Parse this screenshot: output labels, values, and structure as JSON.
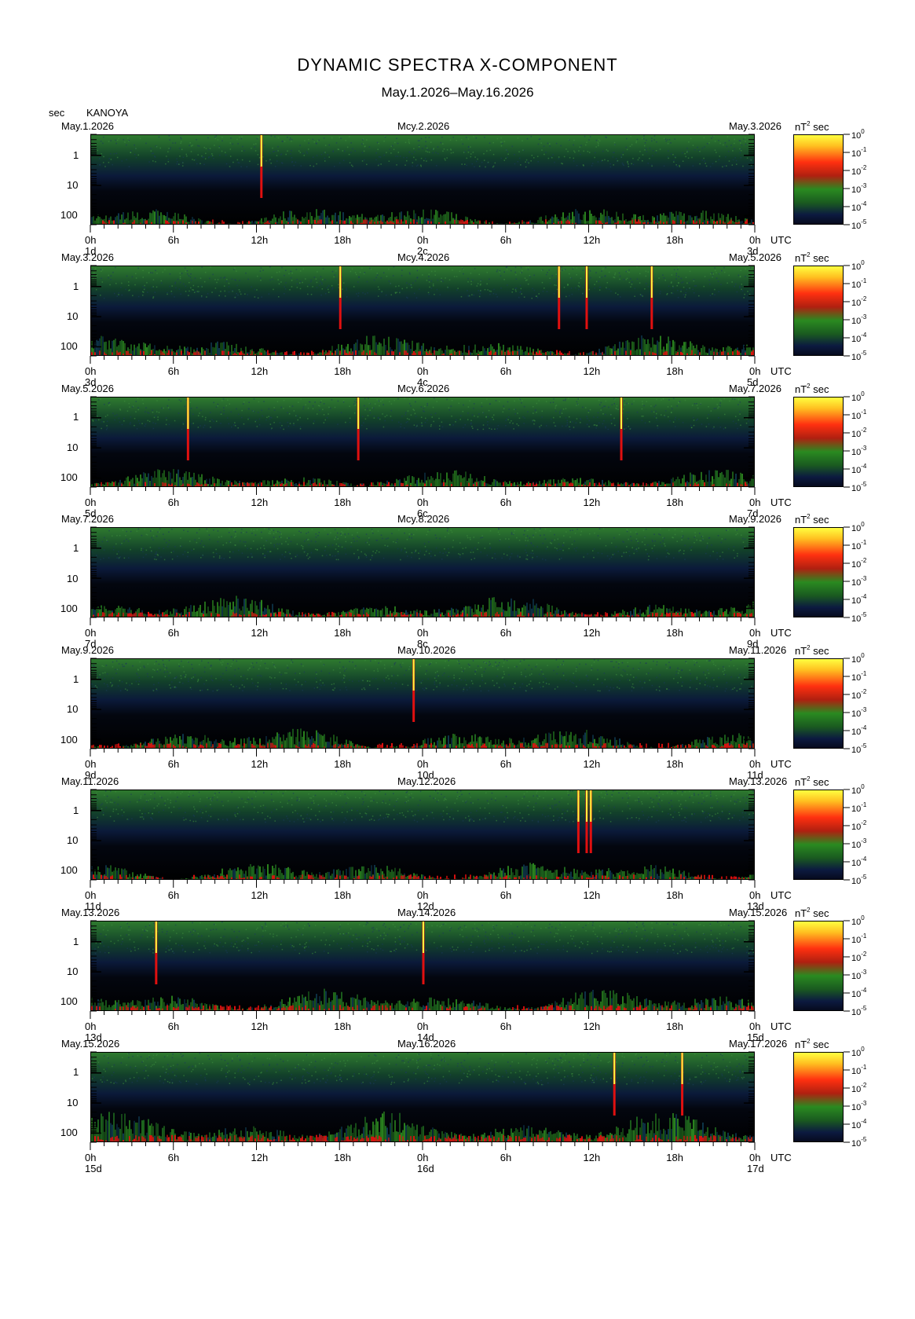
{
  "header": {
    "title": "DYNAMIC SPECTRA X-COMPONENT",
    "subtitle": "May.1.2026–May.16.2026",
    "period_unit": "sec",
    "station": "KANOYA"
  },
  "axis": {
    "x_ticks": [
      "0h",
      "6h",
      "12h",
      "18h",
      "0h",
      "6h",
      "12h",
      "18h",
      "0h"
    ],
    "utc_label": "UTC",
    "y_ticks": [
      "1",
      "10",
      "100"
    ],
    "power_unit_prefix": "nT",
    "power_unit_exp": "2",
    "power_unit_suffix": "sec",
    "colorbar_ticks": [
      {
        "base": "10",
        "exp": "0"
      },
      {
        "base": "10",
        "exp": "-1"
      },
      {
        "base": "10",
        "exp": "-2"
      },
      {
        "base": "10",
        "exp": "-3"
      },
      {
        "base": "10",
        "exp": "-4"
      },
      {
        "base": "10",
        "exp": "-5"
      }
    ]
  },
  "colors": {
    "background": "#000000",
    "low": "#0a1030",
    "mid": "#1f6b1f",
    "high": "#e01010",
    "max": "#ffff40"
  },
  "chart_data": [
    {
      "type": "heatmap",
      "date_left": "May.1.2026",
      "date_mid": "Mcy.2.2026",
      "date_right": "May.3.2026",
      "day_labels": [
        "1d",
        "2c",
        "3d"
      ],
      "spikes_hours": [
        12.3
      ],
      "activity": 0.55
    },
    {
      "type": "heatmap",
      "date_left": "May.3.2026",
      "date_mid": "Mcy.4.2026",
      "date_right": "May.5.2026",
      "day_labels": [
        "3d",
        "4c",
        "5d"
      ],
      "spikes_hours": [
        18,
        33.8,
        35.8,
        40.5
      ],
      "activity": 0.6
    },
    {
      "type": "heatmap",
      "date_left": "May.5.2026",
      "date_mid": "Mcy.6.2026",
      "date_right": "May.7.2026",
      "day_labels": [
        "5d",
        "6c",
        "7d"
      ],
      "spikes_hours": [
        7,
        19.3,
        38.3
      ],
      "activity": 0.5
    },
    {
      "type": "heatmap",
      "date_left": "May.7.2026",
      "date_mid": "Mcy.8.2026",
      "date_right": "May.9.2026",
      "day_labels": [
        "7d",
        "8c",
        "9d"
      ],
      "spikes_hours": [],
      "activity": 0.6
    },
    {
      "type": "heatmap",
      "date_left": "May.9.2026",
      "date_mid": "May.10.2026",
      "date_right": "May.11.2026",
      "day_labels": [
        "9d",
        "10d",
        "11d"
      ],
      "spikes_hours": [
        23.3
      ],
      "activity": 0.6
    },
    {
      "type": "heatmap",
      "date_left": "May.11.2026",
      "date_mid": "May.12.2026",
      "date_right": "May.13.2026",
      "day_labels": [
        "11d",
        "12d",
        "13d"
      ],
      "spikes_hours": [
        35.2,
        35.8,
        36.1
      ],
      "activity": 0.55
    },
    {
      "type": "heatmap",
      "date_left": "May.13.2026",
      "date_mid": "May.14.2026",
      "date_right": "May.15.2026",
      "day_labels": [
        "13d",
        "14d",
        "15d"
      ],
      "spikes_hours": [
        4.7,
        24
      ],
      "activity": 0.65
    },
    {
      "type": "heatmap",
      "date_left": "May.15.2026",
      "date_mid": "May.16.2026",
      "date_right": "May.17.2026",
      "day_labels": [
        "15d",
        "16d",
        "17d"
      ],
      "spikes_hours": [
        37.8,
        42.7
      ],
      "activity": 0.85
    }
  ]
}
